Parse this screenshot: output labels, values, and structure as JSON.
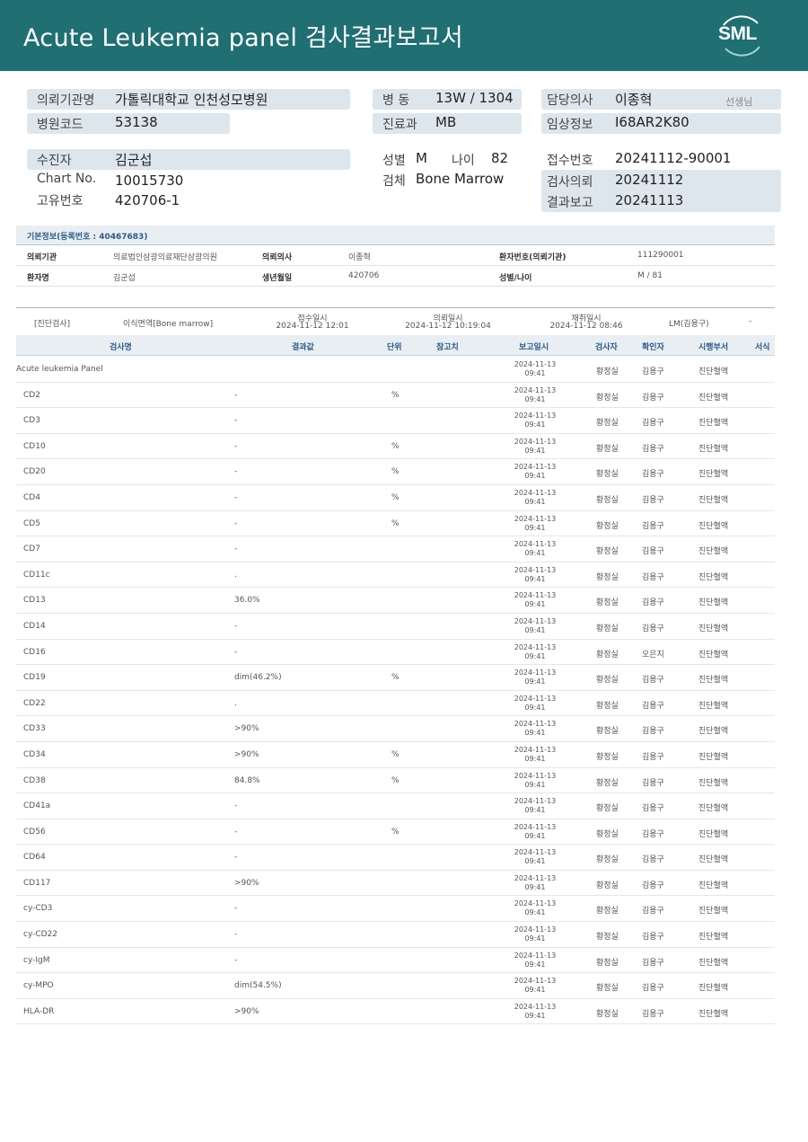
{
  "header": {
    "title": "Acute  Leukemia  panel 검사결과보고서",
    "logo": "SML"
  },
  "info": {
    "hospital_label": "의뢰기관명",
    "hospital": "가톨릭대학교 인천성모병원",
    "code_label": "병원코드",
    "code": "53138",
    "ward_label": "병  동",
    "ward": "13W / 1304",
    "dept_label": "진료과",
    "dept": "MB",
    "doctor_label": "담당의사",
    "doctor": "이종혁",
    "doctor_suffix": "선생님",
    "clinical_label": "임상정보",
    "clinical": "I68AR2K80",
    "patient_label": "수진자",
    "patient": "김군섭",
    "chart_label": "Chart No.",
    "chart": "10015730",
    "uid_label": "고유번호",
    "uid": "420706-1",
    "sex_label": "성별",
    "sex": "M",
    "age_label": "나이",
    "age": "82",
    "specimen_label": "검체",
    "specimen": "Bone Marrow",
    "receipt_label": "접수번호",
    "receipt": "20241112-90001",
    "request_label": "검사의뢰",
    "request": "20241112",
    "report_label": "결과보고",
    "report": "20241113"
  },
  "basic": {
    "title": "기본정보(등록번호 : 40467683)",
    "row1": {
      "k1": "의뢰기관",
      "v1": "의료법인삼광의료재단삼광의원",
      "k2": "의뢰의사",
      "v2": "이종혁",
      "k3": "환자번호(의뢰기관)",
      "v3": "111290001"
    },
    "row2": {
      "k1": "환자명",
      "v1": "김군섭",
      "k2": "생년월일",
      "v2": "420706",
      "k3": "성별/나이",
      "v3": "M / 81"
    }
  },
  "order": {
    "type": "[진단검사]",
    "name": "이식면역[Bone marrow]",
    "receipt_label": "접수일시",
    "receipt": "2024-11-12 12:01",
    "request_label": "의뢰일시",
    "request": "2024-11-12 10:19:04",
    "collect_label": "채취일시",
    "collect": "2024-11-12 08:46",
    "lm": "LM(김용구)",
    "dash": "-"
  },
  "table": {
    "headers": {
      "name": "검사명",
      "result": "결과값",
      "unit": "단위",
      "ref": "참고치",
      "date": "보고일시",
      "tech": "검사자",
      "conf": "확인자",
      "dept": "시행부서",
      "form": "서식"
    },
    "rows": [
      {
        "name": "Acute leukemia Panel",
        "result": "",
        "unit": "",
        "date": "2024-11-13",
        "time": "09:41",
        "tech": "황정실",
        "conf": "김용구",
        "dept": "진단혈액",
        "top": true
      },
      {
        "name": "CD2",
        "result": "-",
        "unit": "%",
        "date": "2024-11-13",
        "time": "09:41",
        "tech": "황정실",
        "conf": "김용구",
        "dept": "진단혈액"
      },
      {
        "name": "CD3",
        "result": "-",
        "unit": "",
        "date": "2024-11-13",
        "time": "09:41",
        "tech": "황정실",
        "conf": "김용구",
        "dept": "진단혈액"
      },
      {
        "name": "CD10",
        "result": "-",
        "unit": "%",
        "date": "2024-11-13",
        "time": "09:41",
        "tech": "황정실",
        "conf": "김용구",
        "dept": "진단혈액"
      },
      {
        "name": "CD20",
        "result": "-",
        "unit": "%",
        "date": "2024-11-13",
        "time": "09:41",
        "tech": "황정실",
        "conf": "김용구",
        "dept": "진단혈액"
      },
      {
        "name": "CD4",
        "result": "-",
        "unit": "%",
        "date": "2024-11-13",
        "time": "09:41",
        "tech": "황정실",
        "conf": "김용구",
        "dept": "진단혈액"
      },
      {
        "name": "CD5",
        "result": "-",
        "unit": "%",
        "date": "2024-11-13",
        "time": "09:41",
        "tech": "황정실",
        "conf": "김용구",
        "dept": "진단혈액"
      },
      {
        "name": "CD7",
        "result": "-",
        "unit": "",
        "date": "2024-11-13",
        "time": "09:41",
        "tech": "황정실",
        "conf": "김용구",
        "dept": "진단혈액"
      },
      {
        "name": "CD11c",
        "result": ".",
        "unit": "",
        "date": "2024-11-13",
        "time": "09:41",
        "tech": "황정실",
        "conf": "김용구",
        "dept": "진단혈액"
      },
      {
        "name": "CD13",
        "result": "36.0%",
        "unit": "",
        "date": "2024-11-13",
        "time": "09:41",
        "tech": "황정실",
        "conf": "김용구",
        "dept": "진단혈액"
      },
      {
        "name": "CD14",
        "result": "-",
        "unit": "",
        "date": "2024-11-13",
        "time": "09:41",
        "tech": "황정실",
        "conf": "김용구",
        "dept": "진단혈액"
      },
      {
        "name": "CD16",
        "result": "-",
        "unit": "",
        "date": "2024-11-13",
        "time": "09:41",
        "tech": "황정실",
        "conf": "오은지",
        "dept": "진단혈액"
      },
      {
        "name": "CD19",
        "result": "dim(46.2%)",
        "unit": "%",
        "date": "2024-11-13",
        "time": "09:41",
        "tech": "황정실",
        "conf": "김용구",
        "dept": "진단혈액"
      },
      {
        "name": "CD22",
        "result": ".",
        "unit": "",
        "date": "2024-11-13",
        "time": "09:41",
        "tech": "황정실",
        "conf": "김용구",
        "dept": "진단혈액"
      },
      {
        "name": "CD33",
        "result": ">90%",
        "unit": "",
        "date": "2024-11-13",
        "time": "09:41",
        "tech": "황정실",
        "conf": "김용구",
        "dept": "진단혈액"
      },
      {
        "name": "CD34",
        "result": ">90%",
        "unit": "%",
        "date": "2024-11-13",
        "time": "09:41",
        "tech": "황정실",
        "conf": "김용구",
        "dept": "진단혈액"
      },
      {
        "name": "CD38",
        "result": "84.8%",
        "unit": "%",
        "date": "2024-11-13",
        "time": "09:41",
        "tech": "황정실",
        "conf": "김용구",
        "dept": "진단혈액"
      },
      {
        "name": "CD41a",
        "result": "-",
        "unit": "",
        "date": "2024-11-13",
        "time": "09:41",
        "tech": "황정실",
        "conf": "김용구",
        "dept": "진단혈액"
      },
      {
        "name": "CD56",
        "result": "-",
        "unit": "%",
        "date": "2024-11-13",
        "time": "09:41",
        "tech": "황정실",
        "conf": "김용구",
        "dept": "진단혈액"
      },
      {
        "name": "CD64",
        "result": "-",
        "unit": "",
        "date": "2024-11-13",
        "time": "09:41",
        "tech": "황정실",
        "conf": "김용구",
        "dept": "진단혈액"
      },
      {
        "name": "CD117",
        "result": ">90%",
        "unit": "",
        "date": "2024-11-13",
        "time": "09:41",
        "tech": "황정실",
        "conf": "김용구",
        "dept": "진단혈액"
      },
      {
        "name": "cy-CD3",
        "result": "-",
        "unit": "",
        "date": "2024-11-13",
        "time": "09:41",
        "tech": "황정실",
        "conf": "김용구",
        "dept": "진단혈액"
      },
      {
        "name": "cy-CD22",
        "result": "-",
        "unit": "",
        "date": "2024-11-13",
        "time": "09:41",
        "tech": "황정실",
        "conf": "김용구",
        "dept": "진단혈액"
      },
      {
        "name": "cy-IgM",
        "result": "-",
        "unit": "",
        "date": "2024-11-13",
        "time": "09:41",
        "tech": "황정실",
        "conf": "김용구",
        "dept": "진단혈액"
      },
      {
        "name": "cy-MPO",
        "result": "dim(54.5%)",
        "unit": "",
        "date": "2024-11-13",
        "time": "09:41",
        "tech": "황정실",
        "conf": "김용구",
        "dept": "진단혈액"
      },
      {
        "name": "HLA-DR",
        "result": ">90%",
        "unit": "",
        "date": "2024-11-13",
        "time": "09:41",
        "tech": "황정실",
        "conf": "김용구",
        "dept": "진단혈액"
      }
    ]
  }
}
